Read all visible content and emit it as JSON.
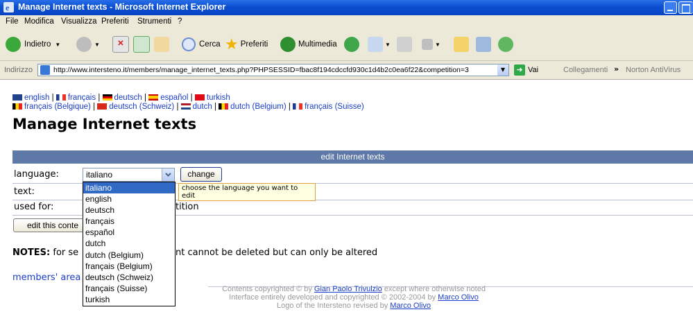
{
  "window": {
    "title": "Manage Internet texts - Microsoft Internet Explorer"
  },
  "menu": [
    "File",
    "Modifica",
    "Visualizza",
    "Preferiti",
    "Strumenti",
    "?"
  ],
  "toolbar": {
    "back": "Indietro",
    "search": "Cerca",
    "favorites": "Preferiti",
    "media": "Multimedia"
  },
  "address": {
    "label": "Indirizzo",
    "url": "http://www.intersteno.it/members/manage_internet_texts.php?PHPSESSID=fbac8f194cdccfd930c1d4b2c0ea6f22&competition=3",
    "go": "Vai",
    "links": "Collegamenti",
    "norton": "Norton AntiVirus"
  },
  "languages_row1": [
    "english",
    "français",
    "deutsch",
    "español",
    "turkish"
  ],
  "languages_row2": [
    "français (Belgique)",
    "deutsch (Schweiz)",
    "dutch",
    "dutch (Belgium)",
    "français (Suisse)"
  ],
  "page": {
    "title": "Manage Internet texts",
    "section_header": "edit Internet texts",
    "language_label": "language:",
    "language_value": "italiano",
    "change_button": "change",
    "tooltip": "choose the language you want to edit",
    "text_label": "text:",
    "used_for_label": "used for:",
    "used_for_value": "tition",
    "edit_button": "edit this conte",
    "notes_label": "NOTES:",
    "notes_left": "for se",
    "notes_right": "nt cannot be deleted but can only be altered",
    "members_link": "members' area"
  },
  "dropdown_options": [
    "italiano",
    "english",
    "deutsch",
    "français",
    "español",
    "dutch",
    "dutch (Belgium)",
    "français (Belgium)",
    "deutsch (Schweiz)",
    "français (Suisse)",
    "turkish"
  ],
  "footer": {
    "line1_pre": "Contents copyrighted © by ",
    "line1_link": "Gian Paolo Trivulzio",
    "line1_post": " except where otherwise noted",
    "line2_pre": "Interface entirely developed and copyrighted © 2002-2004 by ",
    "line2_link": "Marco Olivo",
    "line3_pre": "Logo of the Intersteno revised by ",
    "line3_link": "Marco Olivo"
  },
  "colors": {
    "titlebar": "#0a4fd0",
    "section_header": "#5e78a7",
    "link": "#1a3cc8",
    "selection": "#316ac5"
  }
}
